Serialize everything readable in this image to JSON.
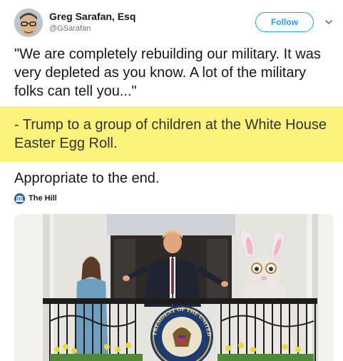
{
  "author": {
    "name": "Greg Sarafan, Esq",
    "handle": "@GSarafan"
  },
  "follow_label": "Follow",
  "tweet": {
    "paragraph_1": "\"We are completely rebuilding our military. It was very depleted as you know. A lot of the military folks can tell you...\"",
    "paragraph_2": "- Trump to a group of children at the White House Easter Egg Roll.",
    "paragraph_3": "Appropriate to the end."
  },
  "highlight_color": "#fbf37c",
  "accent_color": "#1da1f2",
  "source": {
    "name": "The Hill",
    "icon": "the-hill-logo-icon"
  },
  "media": {
    "seal_text": "PRESIDENT OF THE UNITED"
  },
  "icons": {
    "caret": "chevron-down-icon"
  }
}
